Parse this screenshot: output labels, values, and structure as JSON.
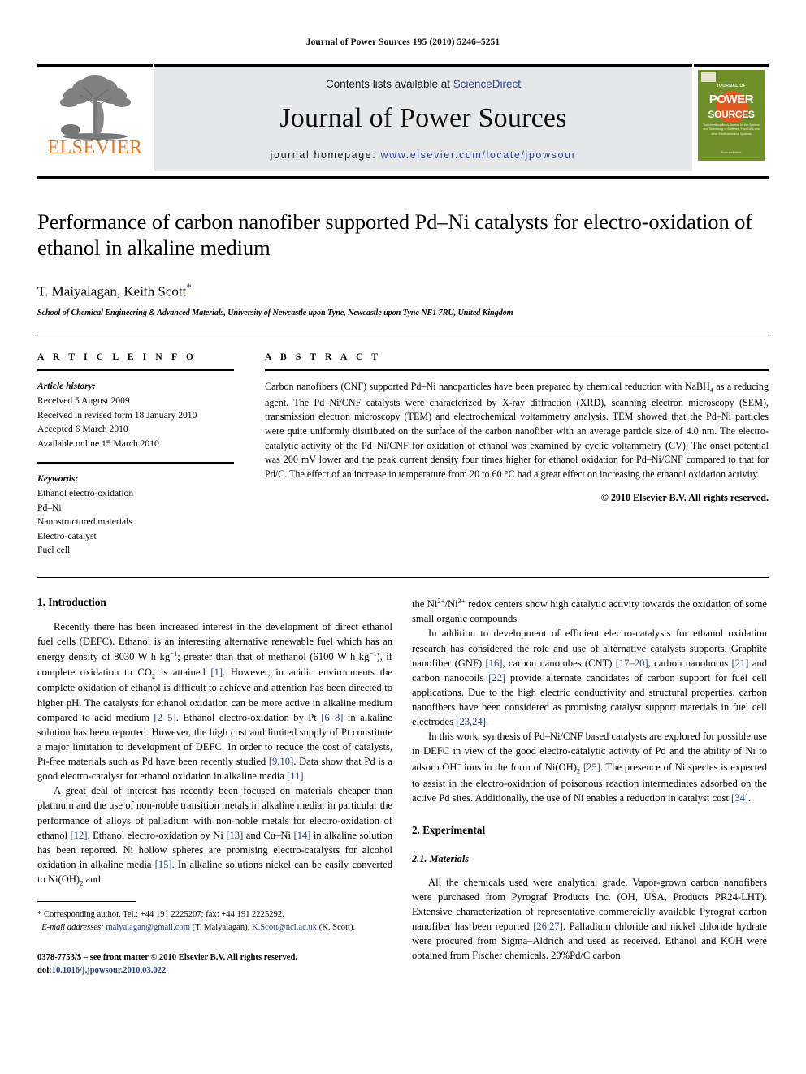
{
  "running_head": "Journal of Power Sources 195 (2010) 5246–5251",
  "masthead": {
    "contents_prefix": "Contents lists available at ",
    "sciencedirect": "ScienceDirect",
    "journal_name": "Journal of Power Sources",
    "homepage_prefix": "journal homepage: ",
    "homepage_url": "www.elsevier.com/locate/jpowsour",
    "publisher_wordmark": "ELSEVIER",
    "publisher_color": "#e87722",
    "link_color": "#2b4a9b",
    "band_color": "#e6e7e9",
    "cover": {
      "top_label": "JOURNAL OF",
      "title_line1": "POWER",
      "title_line2": "SOURCES",
      "blurb": "The Interdisciplinary Journal for the Science and Technology of Batteries, Fuel Cells and other Electrochemical Systems",
      "footer": "ScienceDirect",
      "bg_color": "#6f8f2a",
      "accent_color": "#e2591f"
    }
  },
  "article": {
    "title": "Performance of carbon nanofiber supported Pd–Ni catalysts for electro-oxidation of ethanol in alkaline medium",
    "authors": "T. Maiyalagan, Keith Scott",
    "corresponding_marker": "*",
    "affiliation": "School of Chemical Engineering & Advanced Materials, University of Newcastle upon Tyne, Newcastle upon Tyne NE1 7RU, United Kingdom"
  },
  "article_info": {
    "heading": "A R T I C L E   I N F O",
    "history_label": "Article history:",
    "history": [
      "Received 5 August 2009",
      "Received in revised form 18 January 2010",
      "Accepted 6 March 2010",
      "Available online 15 March 2010"
    ],
    "keywords_label": "Keywords:",
    "keywords": [
      "Ethanol electro-oxidation",
      "Pd–Ni",
      "Nanostructured materials",
      "Electro-catalyst",
      "Fuel cell"
    ]
  },
  "abstract": {
    "heading": "A B S T R A C T",
    "text_part1": "Carbon nanofibers (CNF) supported Pd–Ni nanoparticles have been prepared by chemical reduction with NaBH",
    "text_sub1": "4",
    "text_part2": " as a reducing agent. The Pd–Ni/CNF catalysts were characterized by X-ray diffraction (XRD), scanning electron microscopy (SEM), transmission electron microscopy (TEM) and electrochemical voltammetry analysis. TEM showed that the Pd–Ni particles were quite uniformly distributed on the surface of the carbon nanofiber with an average particle size of 4.0 nm. The electro-catalytic activity of the Pd–Ni/CNF for oxidation of ethanol was examined by cyclic voltammetry (CV). The onset potential was 200 mV lower and the peak current density four times higher for ethanol oxidation for Pd–Ni/CNF compared to that for Pd/C. The effect of an increase in temperature from 20 to 60 °C had a great effect on increasing the ethanol oxidation activity.",
    "copyright": "© 2010 Elsevier B.V. All rights reserved."
  },
  "sections": {
    "introduction_heading": "1.  Introduction",
    "experimental_heading": "2.  Experimental",
    "materials_heading": "2.1.  Materials"
  },
  "left_column": {
    "p1_a": "Recently there has been increased interest in the development of direct ethanol fuel cells (DEFC). Ethanol is an interesting alternative renewable fuel which has an energy density of 8030 W h kg",
    "p1_sup1": "−1",
    "p1_b": "; greater than that of methanol (6100 W h kg",
    "p1_sup2": "−1",
    "p1_c": "), if complete oxidation to CO",
    "p1_sub1": "2",
    "p1_d": " is attained ",
    "p1_ref1": "[1]",
    "p1_e": ". However, in acidic environments the complete oxidation of ethanol is difficult to achieve and attention has been directed to higher pH. The catalysts for ethanol oxidation can be more active in alkaline medium compared to acid medium ",
    "p1_ref2": "[2–5]",
    "p1_f": ". Ethanol electro-oxidation by Pt ",
    "p1_ref3": "[6–8]",
    "p1_g": " in alkaline solution has been reported. However, the high cost and limited supply of Pt constitute a major limitation to development of DEFC. In order to reduce the cost of catalysts, Pt-free materials such as Pd have been recently studied ",
    "p1_ref4": "[9,10]",
    "p1_h": ". Data show that Pd is a good electro-catalyst for ethanol oxidation in alkaline media ",
    "p1_ref5": "[11]",
    "p1_i": ".",
    "p2_a": "A great deal of interest has recently been focused on materials cheaper than platinum and the use of non-noble transition metals in alkaline media; in particular the performance of alloys of palladium with non-noble metals for electro-oxidation of ethanol ",
    "p2_ref1": "[12]",
    "p2_b": ". Ethanol electro-oxidation by Ni ",
    "p2_ref2": "[13]",
    "p2_c": " and Cu–Ni ",
    "p2_ref3": "[14]",
    "p2_d": " in alkaline solution has been reported. Ni hollow spheres are promising electro-catalysts for alcohol oxidation in alkaline media ",
    "p2_ref4": "[15]",
    "p2_e": ". In alkaline solutions nickel can be easily converted to Ni(OH)",
    "p2_sub1": "2",
    "p2_f": " and"
  },
  "right_column": {
    "p1_a": "the Ni",
    "p1_sup1": "2+",
    "p1_b": "/Ni",
    "p1_sup2": "3+",
    "p1_c": " redox centers show high catalytic activity towards the oxidation of some small organic compounds.",
    "p2_a": "In addition to development of efficient electro-catalysts for ethanol oxidation research has considered the role and use of alternative catalysts supports. Graphite nanofiber (GNF) ",
    "p2_ref1": "[16]",
    "p2_b": ", carbon nanotubes (CNT) ",
    "p2_ref2": "[17–20]",
    "p2_c": ", carbon nanohorns ",
    "p2_ref3": "[21]",
    "p2_d": " and carbon nanocoils ",
    "p2_ref4": "[22]",
    "p2_e": " provide alternate candidates of carbon support for fuel cell applications. Due to the high electric conductivity and structural properties, carbon nanofibers have been considered as promising catalyst support materials in fuel cell electrodes ",
    "p2_ref5": "[23,24]",
    "p2_f": ".",
    "p3_a": "In this work, synthesis of Pd–Ni/CNF based catalysts are explored for possible use in DEFC in view of the good electro-catalytic activity of Pd and the ability of Ni to adsorb OH",
    "p3_sup1": "−",
    "p3_b": " ions in the form of Ni(OH)",
    "p3_sub1": "2",
    "p3_c": " ",
    "p3_ref1": "[25]",
    "p3_d": ". The presence of Ni species is expected to assist in the electro-oxidation of poisonous reaction intermediates adsorbed on the active Pd sites. Additionally, the use of Ni enables a reduction in catalyst cost ",
    "p3_ref2": "[34]",
    "p3_e": ".",
    "p4_a": "All the chemicals used were analytical grade. Vapor-grown carbon nanofibers were purchased from Pyrograf Products Inc. (OH, USA, Products PR24-LHT). Extensive characterization of representative commercially available Pyrograf carbon nanofiber has been reported ",
    "p4_ref1": "[26,27]",
    "p4_b": ". Palladium chloride and nickel chloride hydrate were procured from Sigma–Aldrich and used as received. Ethanol and KOH were obtained from Fischer chemicals. 20%Pd/C carbon"
  },
  "footnote": {
    "corresponding": "* Corresponding author. Tel.: +44 191 2225207; fax: +44 191 2225292.",
    "email_label": "E-mail addresses:",
    "email1": "maiyalagan@gmail.com",
    "email1_owner": " (T. Maiyalagan), ",
    "email2": "K.Scott@ncl.ac.uk",
    "email2_owner": "(K. Scott)."
  },
  "footer": {
    "issn_line": "0378-7753/$ – see front matter © 2010 Elsevier B.V. All rights reserved.",
    "doi_label": "doi:",
    "doi_value": "10.1016/j.jpowsour.2010.03.022"
  }
}
